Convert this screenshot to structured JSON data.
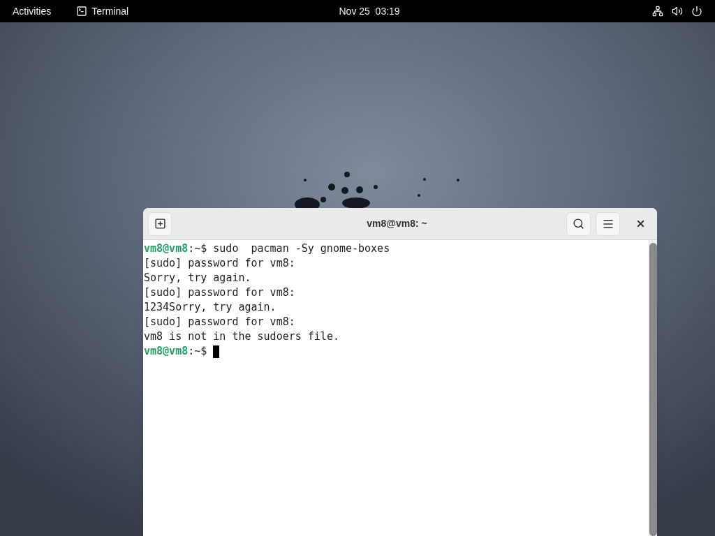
{
  "top_bar": {
    "activities": "Activities",
    "app": "Terminal",
    "clock": "Nov 25  03:19"
  },
  "terminal": {
    "title": "vm8@vm8: ~",
    "lines": [
      {
        "kind": "prompt",
        "user": "vm8@vm8",
        "path": ":~$",
        "command": "sudo  pacman -Sy gnome-boxes"
      },
      {
        "kind": "output",
        "text": "[sudo] password for vm8:"
      },
      {
        "kind": "output",
        "text": "Sorry, try again."
      },
      {
        "kind": "output",
        "text": "[sudo] password for vm8:"
      },
      {
        "kind": "output",
        "text": "1234Sorry, try again."
      },
      {
        "kind": "output",
        "text": "[sudo] password for vm8:"
      },
      {
        "kind": "output",
        "text": "vm8 is not in the sudoers file."
      },
      {
        "kind": "prompt",
        "user": "vm8@vm8",
        "path": ":~$",
        "cursor": true
      }
    ]
  }
}
